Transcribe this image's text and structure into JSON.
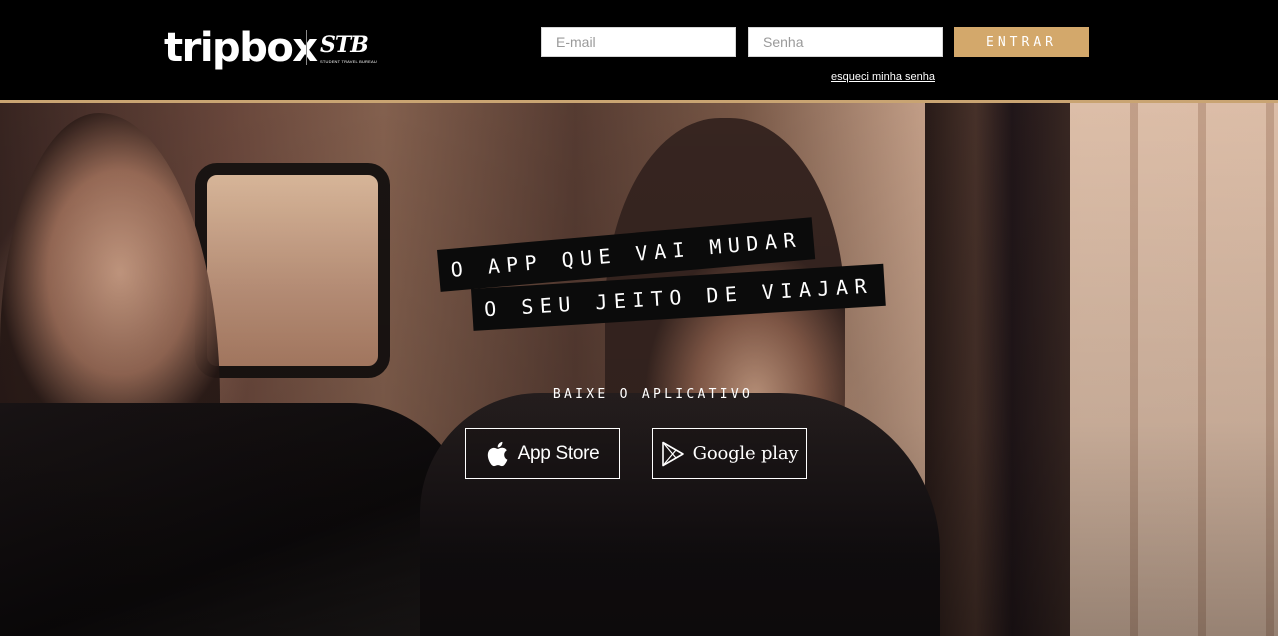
{
  "header": {
    "logo_text": "tripbox",
    "partner_logo_mark": "STB",
    "partner_logo_subtitle": "STUDENT TRAVEL BUREAU",
    "email_placeholder": "E-mail",
    "password_placeholder": "Senha",
    "login_label": "ENTRAR",
    "forgot_password_label": "esqueci minha senha"
  },
  "hero": {
    "tagline_line_1": "O APP QUE VAI MUDAR",
    "tagline_line_2": "O SEU JEITO DE VIAJAR",
    "download_label": "BAIXE O APLICATIVO",
    "app_store_label": "App Store",
    "app_store_icon": "apple-icon",
    "google_play_label": "Google play",
    "google_play_icon": "google-play-icon"
  },
  "colors": {
    "accent": "#d3a86b",
    "header_background": "#000000",
    "header_rule": "#c9a472",
    "tagline_background": "#0b0b0b"
  }
}
